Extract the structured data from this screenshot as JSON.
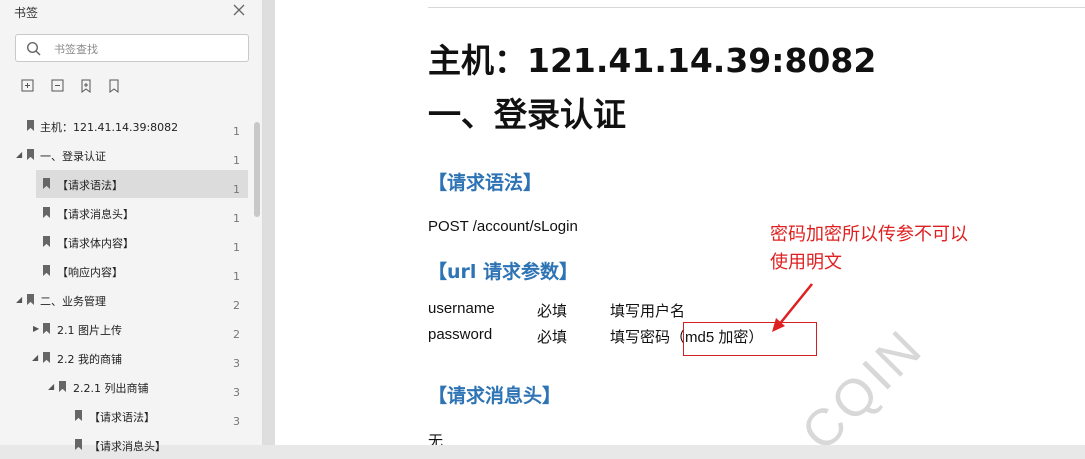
{
  "sidebar": {
    "title": "书签",
    "search_placeholder": "书签查找",
    "items": [
      {
        "label": "主机：121.41.14.39:8082",
        "page": "1"
      },
      {
        "label": "一、登录认证",
        "page": "1"
      },
      {
        "label": "【请求语法】",
        "page": "1"
      },
      {
        "label": "【请求消息头】",
        "page": "1"
      },
      {
        "label": "【请求体内容】",
        "page": "1"
      },
      {
        "label": "【响应内容】",
        "page": "1"
      },
      {
        "label": "二、业务管理",
        "page": "2"
      },
      {
        "label": "2.1 图片上传",
        "page": "2"
      },
      {
        "label": "2.2 我的商铺",
        "page": "3"
      },
      {
        "label": "2.2.1 列出商铺",
        "page": "3"
      },
      {
        "label": "【请求语法】",
        "page": "3"
      },
      {
        "label": "【请求消息头】",
        "page": ""
      }
    ]
  },
  "doc": {
    "host_heading": "主机：121.41.14.39:8082",
    "login_heading": "一、登录认证",
    "sec_syntax": "【请求语法】",
    "request_line": "POST /account/sLogin",
    "sec_url_params": "【url 请求参数】",
    "params": [
      {
        "name": "username",
        "req": "必填",
        "desc": "填写用户名"
      },
      {
        "name": "password",
        "req": "必填",
        "desc": "填写密码（md5 加密）"
      }
    ],
    "sec_headers": "【请求消息头】",
    "headers_value": "无",
    "annotation_line1": "密码加密所以传参不可以",
    "annotation_line2": "使用明文",
    "watermark": "CQIN"
  },
  "colors": {
    "section_blue": "#2e74b5",
    "annotation_red": "#e02020"
  }
}
